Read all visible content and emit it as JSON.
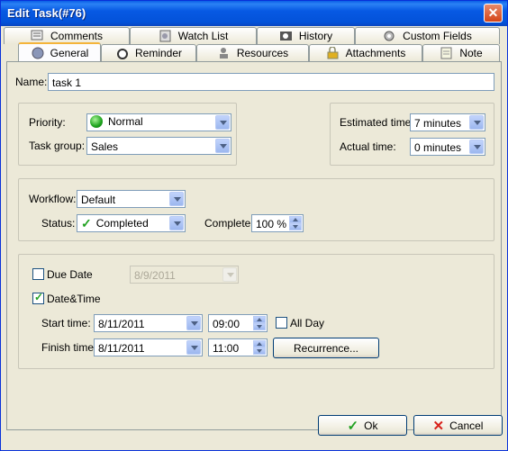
{
  "window": {
    "title": "Edit Task(#76)"
  },
  "tabs_row1": [
    {
      "label": "Comments",
      "icon": "comments-icon"
    },
    {
      "label": "Watch List",
      "icon": "watch-list-icon"
    },
    {
      "label": "History",
      "icon": "history-icon"
    },
    {
      "label": "Custom Fields",
      "icon": "custom-fields-icon"
    }
  ],
  "tabs_row2": [
    {
      "label": "General",
      "icon": "general-icon",
      "active": true
    },
    {
      "label": "Reminder",
      "icon": "alarm-clock-icon"
    },
    {
      "label": "Resources",
      "icon": "resources-icon"
    },
    {
      "label": "Attachments",
      "icon": "attachments-icon"
    },
    {
      "label": "Note",
      "icon": "note-icon"
    }
  ],
  "name": {
    "label": "Name:",
    "value": "task 1"
  },
  "priority": {
    "label": "Priority:",
    "value": "Normal",
    "color": "#1ba11b"
  },
  "task_group": {
    "label": "Task group:",
    "value": "Sales"
  },
  "estimated_time": {
    "label": "Estimated time:",
    "value": "7 minutes"
  },
  "actual_time": {
    "label": "Actual time:",
    "value": "0 minutes"
  },
  "workflow": {
    "label": "Workflow:",
    "value": "Default"
  },
  "status": {
    "label": "Status:",
    "value": "Completed"
  },
  "complete": {
    "label": "Complete:",
    "value": "100 %"
  },
  "due_date": {
    "label": "Due Date",
    "checked": false,
    "value": "8/9/2011"
  },
  "date_time": {
    "label": "Date&Time",
    "checked": true
  },
  "start": {
    "label": "Start time:",
    "date": "8/11/2011",
    "time": "09:00"
  },
  "all_day": {
    "label": "All Day",
    "checked": false
  },
  "finish": {
    "label": "Finish time:",
    "date": "8/11/2011",
    "time": "11:00"
  },
  "recurrence": {
    "label": "Recurrence..."
  },
  "buttons": {
    "ok": "Ok",
    "cancel": "Cancel"
  }
}
